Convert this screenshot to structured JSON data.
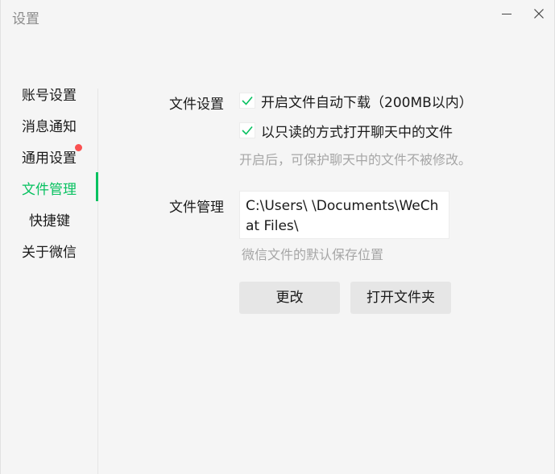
{
  "window": {
    "title": "设置"
  },
  "sidebar": {
    "items": [
      {
        "label": "账号设置",
        "active": false
      },
      {
        "label": "消息通知",
        "active": false
      },
      {
        "label": "通用设置",
        "active": false,
        "badge": "red-dot"
      },
      {
        "label": "文件管理",
        "active": true
      },
      {
        "label": "快捷键",
        "active": false
      },
      {
        "label": "关于微信",
        "active": false
      }
    ]
  },
  "file_settings": {
    "section_label": "文件设置",
    "auto_download": {
      "label": "开启文件自动下载（200MB以内）",
      "checked": true
    },
    "read_only": {
      "label": "以只读的方式打开聊天中的文件",
      "checked": true
    },
    "hint": "开启后，可保护聊天中的文件不被修改。"
  },
  "file_management": {
    "section_label": "文件管理",
    "path": "C:\\Users\\        \\Documents\\WeChat Files\\",
    "hint": "微信文件的默认保存位置",
    "change_button": "更改",
    "open_folder_button": "打开文件夹"
  },
  "colors": {
    "accent": "#07c160",
    "badge": "#fa5151",
    "background": "#f5f5f5",
    "button_bg": "#e6e6e6",
    "hint_text": "#a6a6a6"
  },
  "icons": {
    "minimize": "minimize-icon",
    "close": "close-icon",
    "checkbox": "checkmark-icon"
  }
}
